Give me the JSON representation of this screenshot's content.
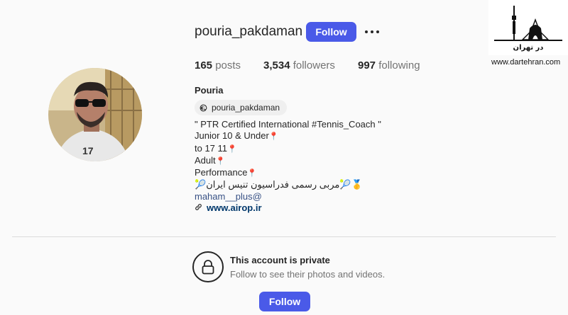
{
  "profile": {
    "username": "pouria_pakdaman",
    "follow_label": "Follow",
    "more_icon": "more-horizontal-icon",
    "stats": {
      "posts_count": "165",
      "posts_label": "posts",
      "followers_count": "3,534",
      "followers_label": "followers",
      "following_count": "997",
      "following_label": "following"
    },
    "full_name": "Pouria",
    "threads_handle": "pouria_pakdaman",
    "bio": {
      "line1": "\" PTR Certified International #Tennis_Coach \"",
      "line2": "Junior 10 & Under",
      "line3": "to 17 11",
      "line4": "Adult",
      "line5": "Performance",
      "line6": "مربی رسمی فدراسیون تنیس ایران",
      "mention": "maham__plus@",
      "link": "www.airop.ir"
    }
  },
  "private_notice": {
    "title": "This account is private",
    "subtitle": "Follow to see their photos and videos.",
    "follow_label": "Follow"
  },
  "watermark": {
    "site": "www.dartehran.com",
    "logo_text": "در تهران"
  },
  "colors": {
    "accent": "#4a5ae8",
    "background": "#fafafa",
    "link": "#00376b",
    "pin": "#e0245e"
  }
}
